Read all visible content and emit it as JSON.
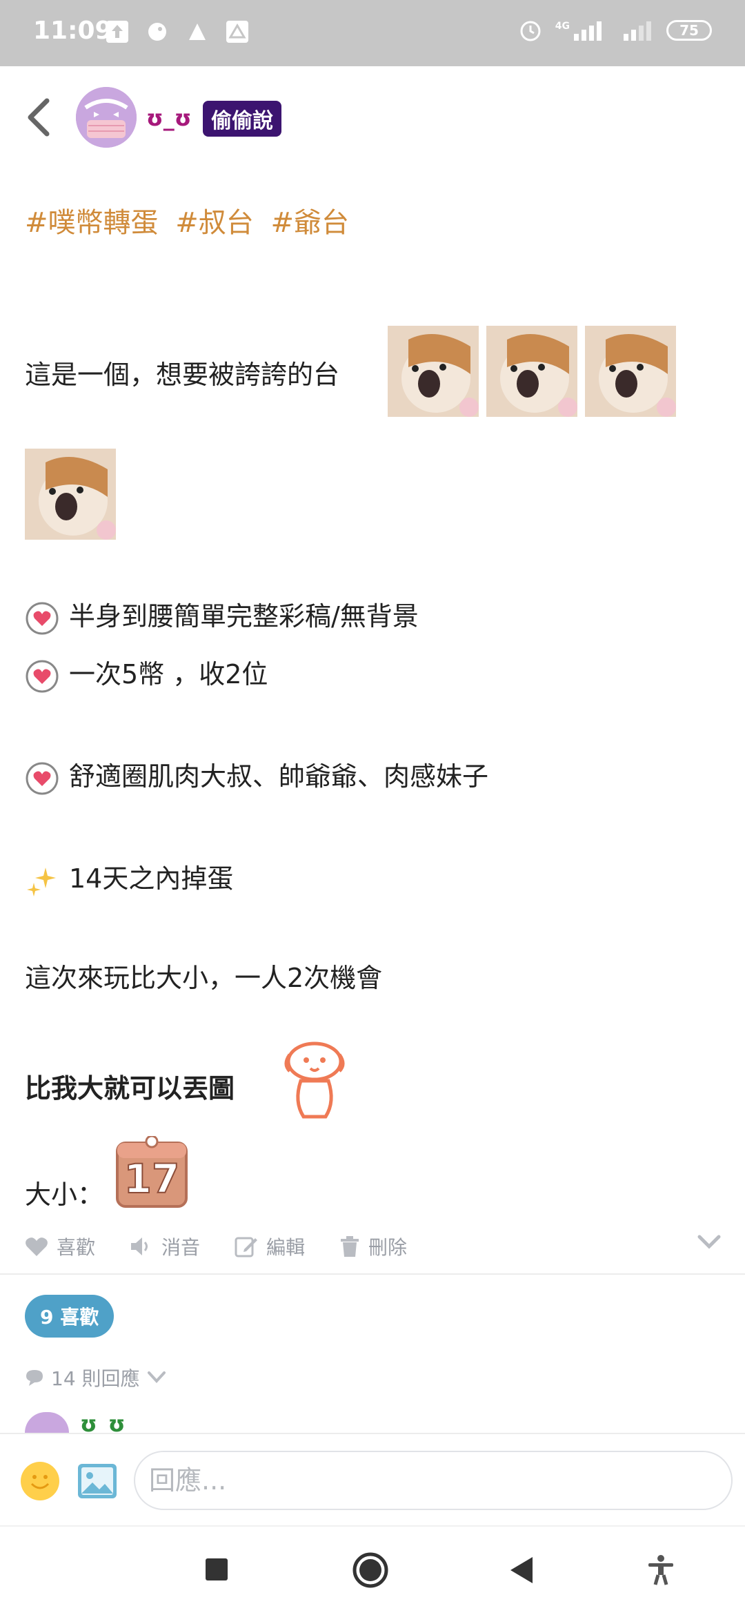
{
  "status_bar": {
    "time": "11:09",
    "network": "4G",
    "battery": "75"
  },
  "header": {
    "username": "ʊ_ʊ",
    "badge": "偷偷說"
  },
  "tags": [
    "#噗幣轉蛋",
    "#叔台",
    "#爺台"
  ],
  "post": {
    "intro": "這是一個，想要被誇誇的台",
    "item1": "半身到腰簡單完整彩稿/無背景",
    "item2": "一次5幣 ，收2位",
    "item3": "舒適圈肌肉大叔、帥爺爺、肉感妹子",
    "item4": "14天之內掉蛋",
    "rule": "這次來玩比大小，一人2次機會",
    "bold_line": "比我大就可以丟圖",
    "size_label": "大小：",
    "size_value": "17"
  },
  "actions": {
    "like": "喜歡",
    "mute": "消音",
    "edit": "編輯",
    "delete": "刪除"
  },
  "likes_count": "9 喜歡",
  "replies_label": "14 則回應",
  "reply_placeholder": "回應..."
}
